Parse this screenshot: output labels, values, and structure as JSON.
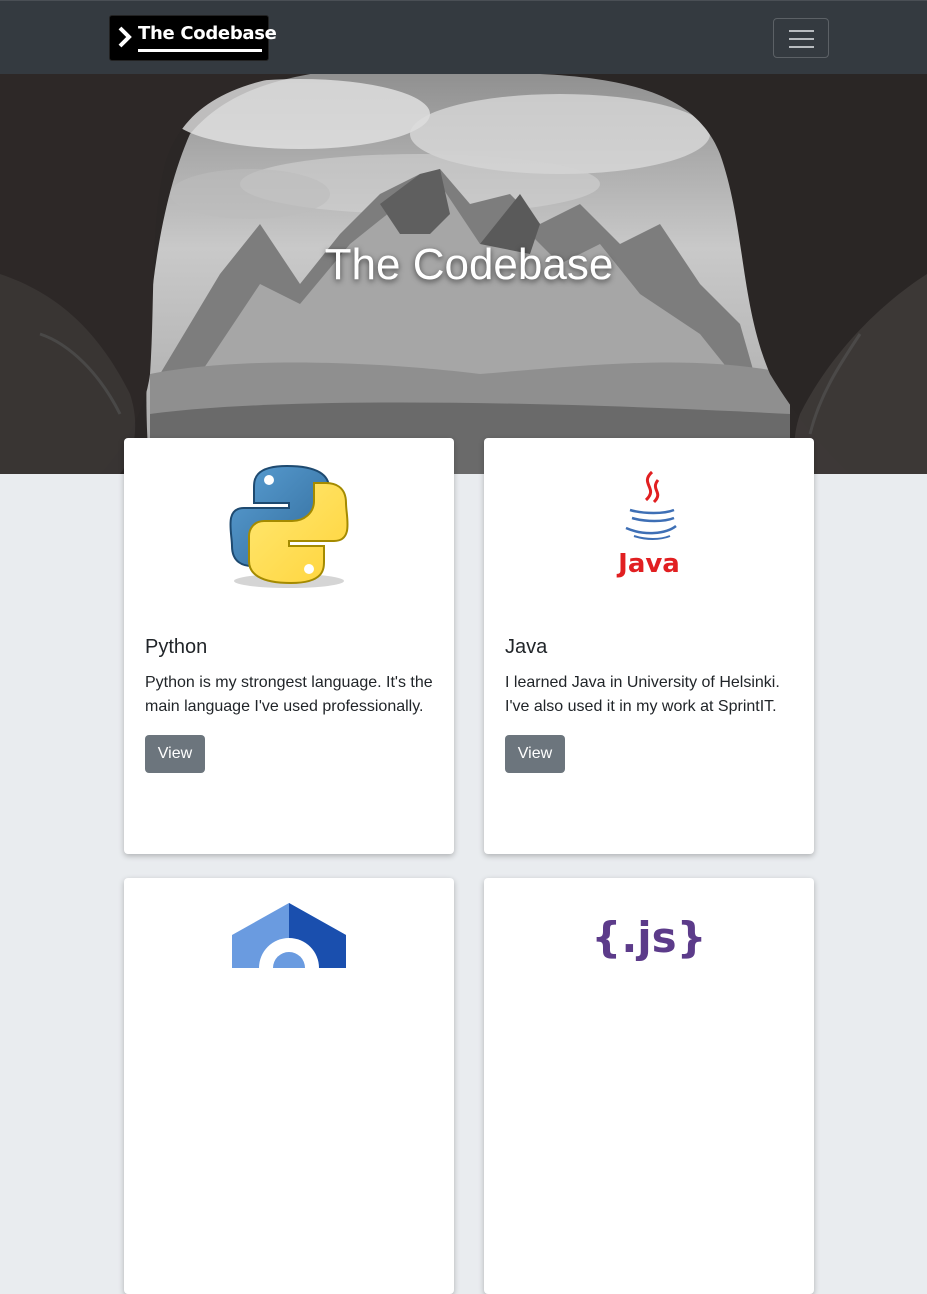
{
  "navbar": {
    "brand_text": "The Codebase",
    "toggler_icon": "hamburger-menu-icon"
  },
  "hero": {
    "title": "The Codebase"
  },
  "cards": [
    {
      "title": "Python",
      "text": "Python is my strongest language. It's the main language I've used professionally.",
      "button": "View",
      "logo": "python-logo"
    },
    {
      "title": "Java",
      "text": "I learned Java in University of Helsinki. I've also used it in my work at SprintIT.",
      "button": "View",
      "logo": "java-logo",
      "logo_text": "Java"
    },
    {
      "logo": "csharp-logo"
    },
    {
      "logo": "javascript-logo",
      "logo_text": "{.js}"
    }
  ],
  "colors": {
    "navbar_bg": "#343a40",
    "button_bg": "#6c757d",
    "page_bg": "#e9ecef",
    "java_red": "#e11f21",
    "java_blue": "#3e6fb5",
    "js_purple": "#5c3b8a"
  }
}
